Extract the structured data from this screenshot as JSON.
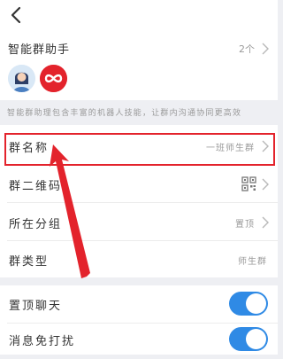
{
  "assistant": {
    "title": "智能群助手",
    "count": "2个",
    "note": "智能群助理包含丰富的机器人技能，让群内沟通协同更高效"
  },
  "rows": [
    {
      "label": "群名称",
      "value": "一班师生群"
    },
    {
      "label": "群二维码",
      "value": ""
    },
    {
      "label": "所在分组",
      "value": "置顶"
    },
    {
      "label": "群类型",
      "value": "师生群"
    }
  ],
  "toggles": [
    {
      "label": "置顶聊天",
      "on": true
    },
    {
      "label": "消息免打扰",
      "on": true
    }
  ],
  "colors": {
    "accent": "#2f8ae5",
    "highlight": "#e3232c"
  }
}
